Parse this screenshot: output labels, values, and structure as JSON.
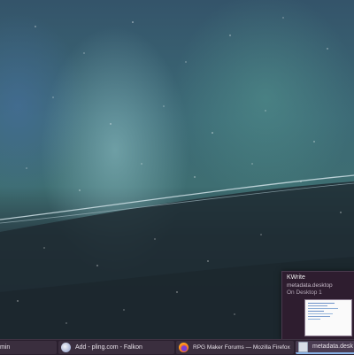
{
  "tooltip": {
    "app_name": "KWrite",
    "file_name": "metadata.desktop",
    "desktop": "On Desktop 1"
  },
  "taskbar": {
    "tasks": [
      {
        "label": "min",
        "icon": "app-icon"
      },
      {
        "label": "Add - pling.com - Falkon",
        "icon": "falkon-icon"
      },
      {
        "label": "RPG Maker Forums — Mozilla Firefox",
        "icon": "firefox-icon"
      },
      {
        "label": "metadata.desk",
        "icon": "kwrite-icon"
      }
    ]
  },
  "colors": {
    "taskbar_bg": "#2a1f2e",
    "tooltip_bg": "#2e1d2f",
    "active_indicator": "#8ab4e8"
  }
}
